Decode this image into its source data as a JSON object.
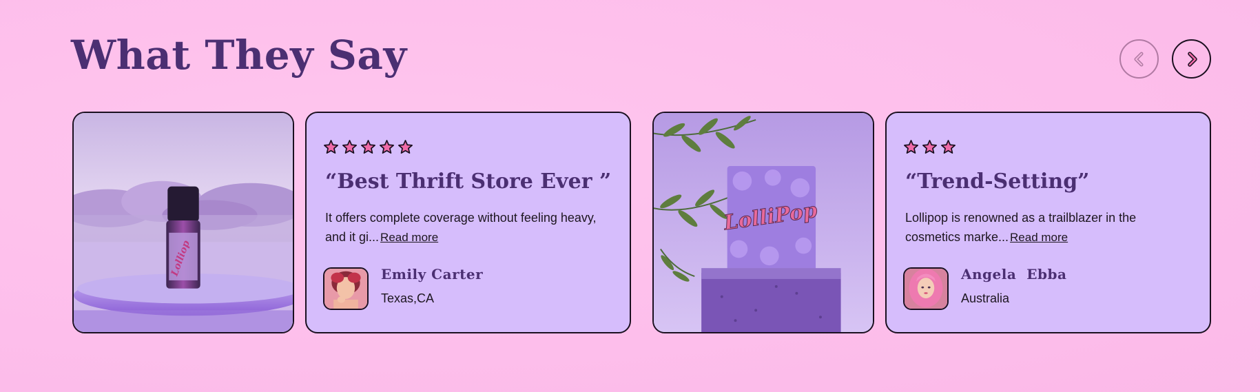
{
  "section": {
    "title": "What They Say"
  },
  "nav": {
    "prev_icon": "chevron-left-icon",
    "next_icon": "chevron-right-icon"
  },
  "colors": {
    "background": "#fdbeeb",
    "heading": "#4b2f72",
    "card": "#d6bdfc",
    "star": "#f06aa8"
  },
  "reviews": [
    {
      "rating": 5,
      "title": "“Best Thrift Store Ever ”",
      "text": "It offers complete coverage without feeling heavy, and it gi...",
      "read_more": "Read more",
      "name": "Emily Carter",
      "location": "Texas,CA"
    },
    {
      "rating": 3,
      "title": "“Trend-Setting”",
      "text": "Lollipop is renowned as a trailblazer in the cosmetics marke...",
      "read_more": "Read more",
      "name": "Angela  Ebba",
      "location": "Australia"
    }
  ],
  "images": [
    {
      "icon": "perfume-bottle-product-image",
      "logo_text": "Lolliop"
    },
    {
      "icon": "lollipop-packaging-product-image",
      "logo_text": "LolliPop"
    }
  ]
}
